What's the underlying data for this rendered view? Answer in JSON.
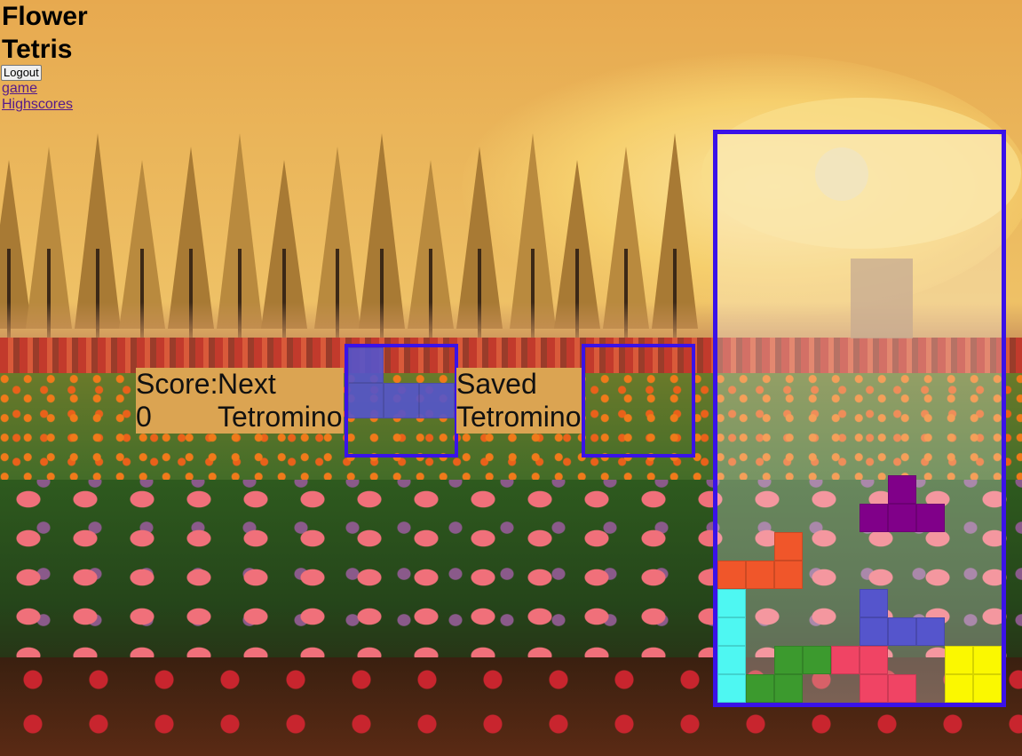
{
  "page": {
    "title": "Flower Tetris"
  },
  "header": {
    "logout_label": "Logout"
  },
  "nav": {
    "game_label": "game",
    "highscores_label": "Highscores"
  },
  "hud": {
    "score_label": "Score:",
    "score_value": "0",
    "next_label": "Next Tetromino",
    "saved_label": "Saved Tetromino"
  },
  "colors": {
    "frame": "#3a12e8",
    "hud_bg": "#dba452",
    "piece_cyan": "#4ef7f2",
    "piece_orange": "#f0562a",
    "piece_green": "#3c9a2e",
    "piece_pink": "#f04464",
    "piece_purple": "#800089",
    "piece_blue": "#5555cc",
    "piece_yellow": "#fbf800"
  },
  "next_piece": {
    "color": "#5555cc",
    "cells": [
      [
        0,
        0
      ],
      [
        0,
        1
      ],
      [
        1,
        1
      ],
      [
        2,
        1
      ]
    ]
  },
  "saved_piece": {
    "cells": []
  },
  "board": {
    "cols": 10,
    "rows": 20,
    "cells": [
      {
        "col": 6,
        "row": 12,
        "color": "#800089"
      },
      {
        "col": 5,
        "row": 13,
        "color": "#800089"
      },
      {
        "col": 6,
        "row": 13,
        "color": "#800089"
      },
      {
        "col": 7,
        "row": 13,
        "color": "#800089"
      },
      {
        "col": 2,
        "row": 14,
        "color": "#f0562a"
      },
      {
        "col": 0,
        "row": 15,
        "color": "#f0562a"
      },
      {
        "col": 1,
        "row": 15,
        "color": "#f0562a"
      },
      {
        "col": 2,
        "row": 15,
        "color": "#f0562a"
      },
      {
        "col": 0,
        "row": 16,
        "color": "#4ef7f2"
      },
      {
        "col": 0,
        "row": 17,
        "color": "#4ef7f2"
      },
      {
        "col": 0,
        "row": 18,
        "color": "#4ef7f2"
      },
      {
        "col": 0,
        "row": 19,
        "color": "#4ef7f2"
      },
      {
        "col": 5,
        "row": 16,
        "color": "#5555cc"
      },
      {
        "col": 5,
        "row": 17,
        "color": "#5555cc"
      },
      {
        "col": 6,
        "row": 17,
        "color": "#5555cc"
      },
      {
        "col": 7,
        "row": 17,
        "color": "#5555cc"
      },
      {
        "col": 2,
        "row": 18,
        "color": "#3c9a2e"
      },
      {
        "col": 3,
        "row": 18,
        "color": "#3c9a2e"
      },
      {
        "col": 1,
        "row": 19,
        "color": "#3c9a2e"
      },
      {
        "col": 2,
        "row": 19,
        "color": "#3c9a2e"
      },
      {
        "col": 4,
        "row": 18,
        "color": "#f04464"
      },
      {
        "col": 5,
        "row": 18,
        "color": "#f04464"
      },
      {
        "col": 5,
        "row": 19,
        "color": "#f04464"
      },
      {
        "col": 6,
        "row": 19,
        "color": "#f04464"
      },
      {
        "col": 8,
        "row": 18,
        "color": "#fbf800"
      },
      {
        "col": 9,
        "row": 18,
        "color": "#fbf800"
      },
      {
        "col": 8,
        "row": 19,
        "color": "#fbf800"
      },
      {
        "col": 9,
        "row": 19,
        "color": "#fbf800"
      }
    ]
  }
}
